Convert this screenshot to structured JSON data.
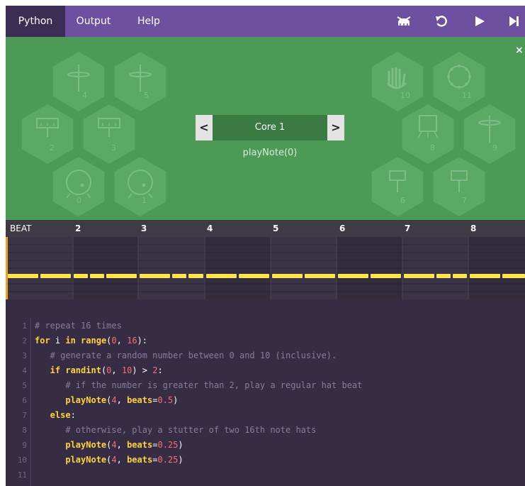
{
  "menu": {
    "tabs": [
      {
        "label": "Python",
        "active": true
      },
      {
        "label": "Output",
        "active": false
      },
      {
        "label": "Help",
        "active": false
      }
    ],
    "toolbar_icons": [
      "drum-kit-icon",
      "undo-icon",
      "play-icon",
      "step-forward-icon"
    ]
  },
  "instruments": {
    "left": [
      "4",
      "5",
      "2",
      "3",
      "0",
      "1"
    ],
    "right": [
      "10",
      "11",
      "8",
      "9",
      "6",
      "7"
    ],
    "close_label": "×"
  },
  "core_selector": {
    "prev_label": "<",
    "label": "Core 1",
    "next_label": ">",
    "preview": "playNote(0)"
  },
  "timeline": {
    "header": "BEAT",
    "beats": [
      "2",
      "3",
      "4",
      "5",
      "6",
      "7",
      "8"
    ]
  },
  "editor": {
    "lines": [
      {
        "n": "1",
        "tokens": [
          {
            "t": "# repeat 16 times",
            "c": "cm"
          }
        ]
      },
      {
        "n": "2",
        "tokens": [
          {
            "t": "for ",
            "c": "kw"
          },
          {
            "t": "i ",
            "c": "tx"
          },
          {
            "t": "in ",
            "c": "kw"
          },
          {
            "t": "range",
            "c": "kw"
          },
          {
            "t": "(",
            "c": "op"
          },
          {
            "t": "0",
            "c": "nm"
          },
          {
            "t": ", ",
            "c": "op"
          },
          {
            "t": "16",
            "c": "nm"
          },
          {
            "t": "):",
            "c": "op"
          }
        ]
      },
      {
        "n": "3",
        "tokens": [
          {
            "t": "   # generate a random number between 0 and 10 (inclusive).",
            "c": "cm"
          }
        ]
      },
      {
        "n": "4",
        "tokens": [
          {
            "t": "   if ",
            "c": "kw"
          },
          {
            "t": "randint",
            "c": "kw"
          },
          {
            "t": "(",
            "c": "op"
          },
          {
            "t": "0",
            "c": "nm"
          },
          {
            "t": ", ",
            "c": "op"
          },
          {
            "t": "10",
            "c": "nm"
          },
          {
            "t": ") > ",
            "c": "op"
          },
          {
            "t": "2",
            "c": "nm"
          },
          {
            "t": ":",
            "c": "op"
          }
        ]
      },
      {
        "n": "5",
        "tokens": [
          {
            "t": "      # if the number is greater than 2, play a regular hat beat",
            "c": "cm"
          }
        ]
      },
      {
        "n": "6",
        "tokens": [
          {
            "t": "      playNote",
            "c": "kw"
          },
          {
            "t": "(",
            "c": "op"
          },
          {
            "t": "4",
            "c": "nm"
          },
          {
            "t": ", ",
            "c": "op"
          },
          {
            "t": "beats",
            "c": "kw"
          },
          {
            "t": "=",
            "c": "op"
          },
          {
            "t": "0.5",
            "c": "nm"
          },
          {
            "t": ")",
            "c": "op"
          }
        ]
      },
      {
        "n": "7",
        "tokens": [
          {
            "t": "   else",
            "c": "kw"
          },
          {
            "t": ":",
            "c": "op"
          }
        ]
      },
      {
        "n": "8",
        "tokens": [
          {
            "t": "      # otherwise, play a stutter of two 16th note hats",
            "c": "cm"
          }
        ]
      },
      {
        "n": "9",
        "tokens": [
          {
            "t": "      playNote",
            "c": "kw"
          },
          {
            "t": "(",
            "c": "op"
          },
          {
            "t": "4",
            "c": "nm"
          },
          {
            "t": ", ",
            "c": "op"
          },
          {
            "t": "beats",
            "c": "kw"
          },
          {
            "t": "=",
            "c": "op"
          },
          {
            "t": "0.25",
            "c": "nm"
          },
          {
            "t": ")",
            "c": "op"
          }
        ]
      },
      {
        "n": "10",
        "tokens": [
          {
            "t": "      playNote",
            "c": "kw"
          },
          {
            "t": "(",
            "c": "op"
          },
          {
            "t": "4",
            "c": "nm"
          },
          {
            "t": ", ",
            "c": "op"
          },
          {
            "t": "beats",
            "c": "kw"
          },
          {
            "t": "=",
            "c": "op"
          },
          {
            "t": "0.25",
            "c": "nm"
          },
          {
            "t": ")",
            "c": "op"
          }
        ]
      },
      {
        "n": "11",
        "tokens": []
      }
    ]
  }
}
